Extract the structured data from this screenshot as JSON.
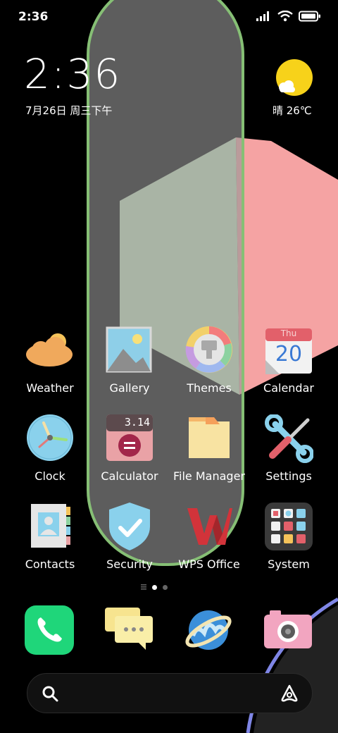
{
  "status_bar": {
    "time": "2:36",
    "icons": [
      "signal-icon",
      "wifi-icon",
      "battery-icon"
    ]
  },
  "clock_widget": {
    "time": "2:36",
    "date": "7月26日 周三下午"
  },
  "weather_widget": {
    "icon": "sun-cloud-icon",
    "text": "晴 26℃"
  },
  "apps": [
    {
      "label": "Weather"
    },
    {
      "label": "Gallery"
    },
    {
      "label": "Themes"
    },
    {
      "label": "Calendar",
      "day_short": "Thu",
      "day_number": "20"
    },
    {
      "label": "Clock"
    },
    {
      "label": "Calculator",
      "display": "3.14"
    },
    {
      "label": "File Manager"
    },
    {
      "label": "Settings"
    },
    {
      "label": "Contacts"
    },
    {
      "label": "Security"
    },
    {
      "label": "WPS Office"
    },
    {
      "label": "System"
    }
  ],
  "dock": {
    "apps": [
      "phone-app",
      "messages-app",
      "browser-app",
      "camera-app"
    ]
  },
  "page_indicator": {
    "pages": 2,
    "current": 1
  },
  "colors": {
    "pill_border": "#86bf75",
    "pink_shape": "#f5a3a3",
    "green_shape": "#c9e5bd",
    "arc": "#7f86e6"
  }
}
